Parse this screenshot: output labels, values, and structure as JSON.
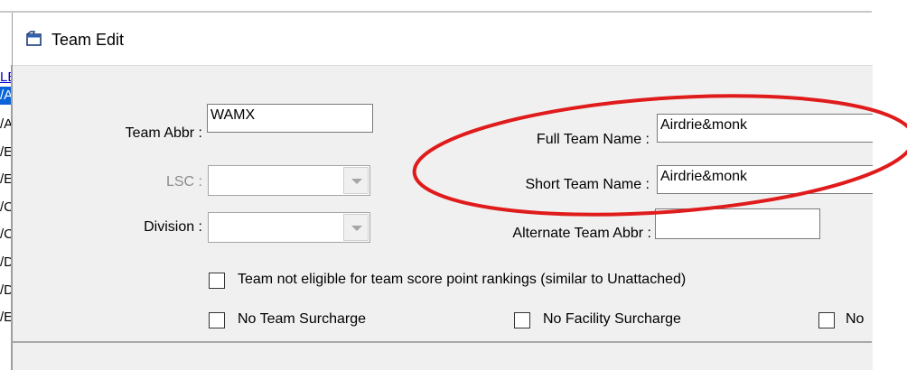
{
  "window": {
    "title": "Team Edit"
  },
  "background_list": {
    "rows": [
      "LB",
      "/A",
      "/A",
      "/E",
      "/E",
      "/C",
      "/C",
      "/D",
      "/D",
      "/E"
    ]
  },
  "form": {
    "team_abbr": {
      "label": "Team Abbr :",
      "value": "WAMX"
    },
    "lsc": {
      "label": "LSC :",
      "value": ""
    },
    "division": {
      "label": "Division :",
      "value": ""
    },
    "full_team_name": {
      "label": "Full Team Name :",
      "value": "Airdrie&monk"
    },
    "short_team_name": {
      "label": "Short Team Name :",
      "value": "Airdrie&monk"
    },
    "alternate_team_abbr": {
      "label": "Alternate Team Abbr :",
      "value": ""
    },
    "checkboxes": {
      "not_eligible": {
        "label": "Team not eligible for team score point rankings (similar to Unattached)",
        "checked": false
      },
      "no_team_surcharge": {
        "label": "No Team Surcharge",
        "checked": false
      },
      "no_facility_surcharge": {
        "label": "No Facility Surcharge",
        "checked": false
      },
      "no_truncated": {
        "label": "No",
        "checked": false
      }
    }
  },
  "colors": {
    "highlight_ellipse": "#e01b1b",
    "selection": "#0a64d8"
  }
}
